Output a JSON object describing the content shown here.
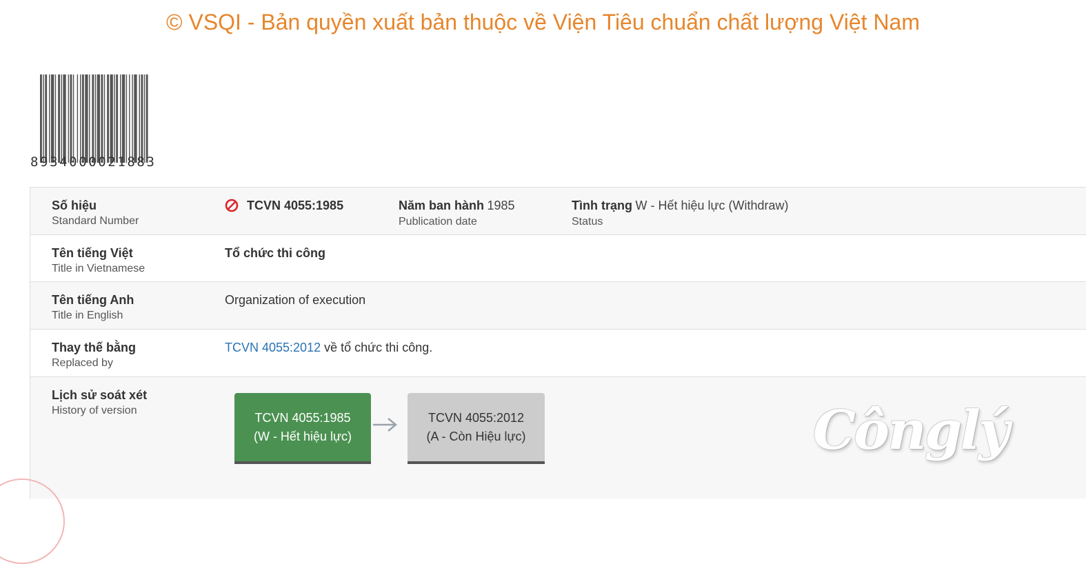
{
  "header": {
    "copyright": "© VSQI - Bản quyền xuất bản thuộc về Viện Tiêu chuẩn chất lượng Việt Nam"
  },
  "barcode": {
    "digits": "8934000021883"
  },
  "rows": {
    "standard_number": {
      "label_vi": "Số hiệu",
      "label_en": "Standard Number",
      "value": "TCVN 4055:1985",
      "icon": "ban-icon"
    },
    "publication": {
      "label_vi": "Năm ban hành",
      "value": "1985",
      "label_en": "Publication date"
    },
    "status": {
      "label_vi": "Tình trạng",
      "value": "W - Hết hiệu lực (Withdraw)",
      "label_en": "Status"
    },
    "title_vi": {
      "label_vi": "Tên tiếng Việt",
      "label_en": "Title in Vietnamese",
      "value": "Tổ chức thi công"
    },
    "title_en": {
      "label_vi": "Tên tiếng Anh",
      "label_en": "Title in English",
      "value": "Organization of execution"
    },
    "replaced_by": {
      "label_vi": "Thay thế bằng",
      "label_en": "Replaced by",
      "link": "TCVN 4055:2012",
      "suffix": " về tổ chức thi công."
    },
    "history": {
      "label_vi": "Lịch sử soát xét",
      "label_en": "History of version",
      "versions": [
        {
          "code": "TCVN 4055:1985",
          "status": "(W - Hết hiệu lực)",
          "color": "#4b9152"
        },
        {
          "code": "TCVN 4055:2012",
          "status": "(A - Còn Hiệu lực)",
          "color": "#cccccc"
        }
      ]
    }
  },
  "watermark": {
    "text": "Cônglý"
  },
  "colors": {
    "accent": "#e6862c",
    "link": "#2a73b3",
    "withdrawn": "#4b9152",
    "ban": "#d9262c"
  }
}
